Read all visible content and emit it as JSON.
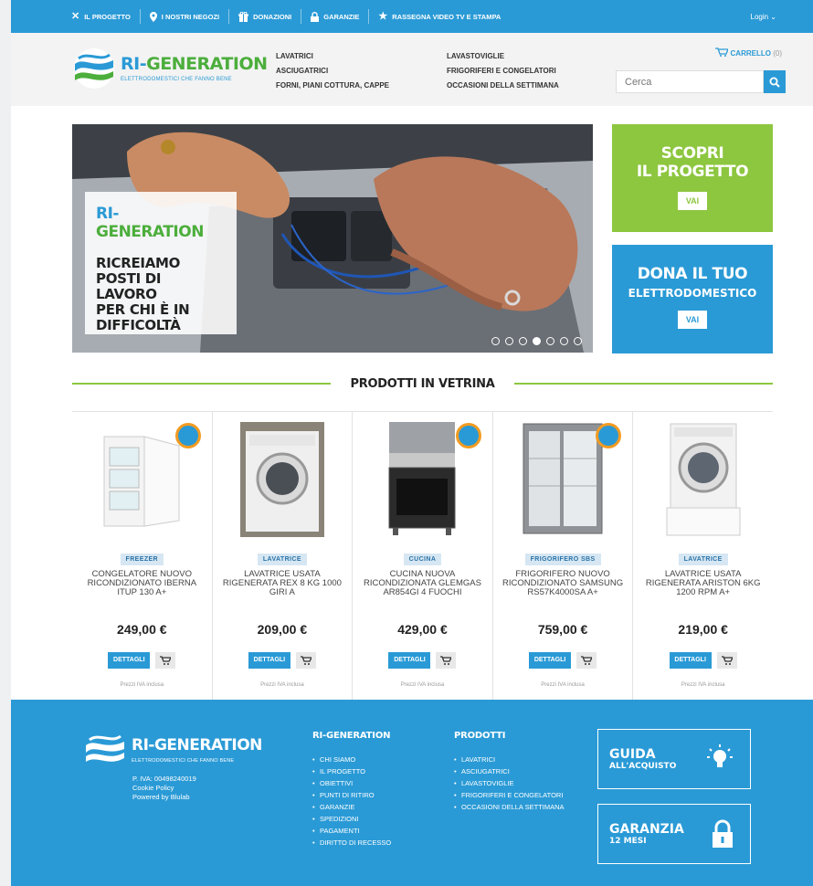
{
  "topbar": {
    "items": [
      {
        "label": "Il progetto",
        "icon": "tools-icon"
      },
      {
        "label": "I nostri negozi",
        "icon": "map-pin-icon"
      },
      {
        "label": "Donazioni",
        "icon": "gift-icon"
      },
      {
        "label": "Garanzie",
        "icon": "lock-icon"
      },
      {
        "label": "Rassegna video TV e stampa",
        "icon": "star-icon"
      }
    ],
    "login": "Login ⌄"
  },
  "brand": {
    "ri": "RI-",
    "generation": "GENERATION",
    "tagline": "ELETTRODOMESTICI CHE FANNO BENE"
  },
  "nav": {
    "col1": [
      "Lavatrici",
      "Asciugatrici",
      "Forni, piani cottura, cappe"
    ],
    "col2": [
      "Lavastoviglie",
      "Frigoriferi e congelatori",
      "Occasioni della settimana"
    ]
  },
  "cart": {
    "label": "CARRELLO",
    "count": "(0)"
  },
  "search": {
    "placeholder": "Cerca"
  },
  "hero": {
    "brand_ri": "RI-",
    "brand_gen": "GENERATION",
    "claim": [
      "RICREIAMO",
      "POSTI DI LAVORO",
      "PER CHI È IN",
      "DIFFICOLTÀ"
    ],
    "slides": 7,
    "active_slide": 4
  },
  "promos": {
    "scopri": {
      "line1": "SCOPRI",
      "line2": "IL PROGETTO",
      "button": "VAI"
    },
    "dona": {
      "line1": "DONA IL TUO",
      "line2": "ELETTRODOMESTICO",
      "button": "VAI"
    }
  },
  "section_title": "PRODOTTI IN VETRINA",
  "products": [
    {
      "tag": "FREEZER",
      "name": "CONGELATORE NUOVO RICONDIZIONATO IBERNA ITUP 130 A+",
      "price": "249,00 €",
      "details": "DETTAGLI",
      "iva": "Prezzi IVA inclusa",
      "badge": true
    },
    {
      "tag": "LAVATRICE",
      "name": "LAVATRICE USATA RIGENERATA REX 8 KG 1000 GIRI A",
      "price": "209,00 €",
      "details": "DETTAGLI",
      "iva": "Prezzi IVA inclusa",
      "badge": false
    },
    {
      "tag": "CUCINA",
      "name": "CUCINA NUOVA RICONDIZIONATA GLEMGAS AR854GI 4 FUOCHI",
      "price": "429,00 €",
      "details": "DETTAGLI",
      "iva": "Prezzi IVA inclusa",
      "badge": true
    },
    {
      "tag": "FRIGORIFERO SBS",
      "name": "FRIGORIFERO NUOVO RICONDIZIONATO SAMSUNG RS57K4000SA A+",
      "price": "759,00 €",
      "details": "DETTAGLI",
      "iva": "Prezzi IVA inclusa",
      "badge": true
    },
    {
      "tag": "LAVATRICE",
      "name": "LAVATRICE USATA RIGENERATA ARISTON 6KG 1200 RPM A+",
      "price": "219,00 €",
      "details": "DETTAGLI",
      "iva": "Prezzi IVA inclusa",
      "badge": false
    }
  ],
  "footer": {
    "brand": "RI-GENERATION",
    "tagline": "ELETTRODOMESTICI CHE FANNO BENE",
    "info": [
      "P. IVA: 00498240019",
      "Cookie Policy",
      "Powered by Blulab"
    ],
    "col1": {
      "title": "RI-GENERATION",
      "items": [
        "Chi siamo",
        "Il progetto",
        "Obiettivi",
        "Punti di ritiro",
        "Garanzie",
        "Spedizioni",
        "Pagamenti",
        "Diritto di recesso"
      ]
    },
    "col2": {
      "title": "PRODOTTI",
      "items": [
        "Lavatrici",
        "Asciugatrici",
        "Lavastoviglie",
        "Frigoriferi e congelatori",
        "Occasioni della settimana"
      ]
    },
    "guida": {
      "title": "GUIDA",
      "sub": "ALL'ACQUISTO",
      "icon": "lightbulb-icon"
    },
    "garanzia": {
      "title": "GARANZIA",
      "sub": "12 MESI",
      "icon": "lock-icon"
    }
  },
  "colors": {
    "blue": "#2a9ad6",
    "green": "#8dc63f",
    "logo_green": "#4cae3c"
  }
}
